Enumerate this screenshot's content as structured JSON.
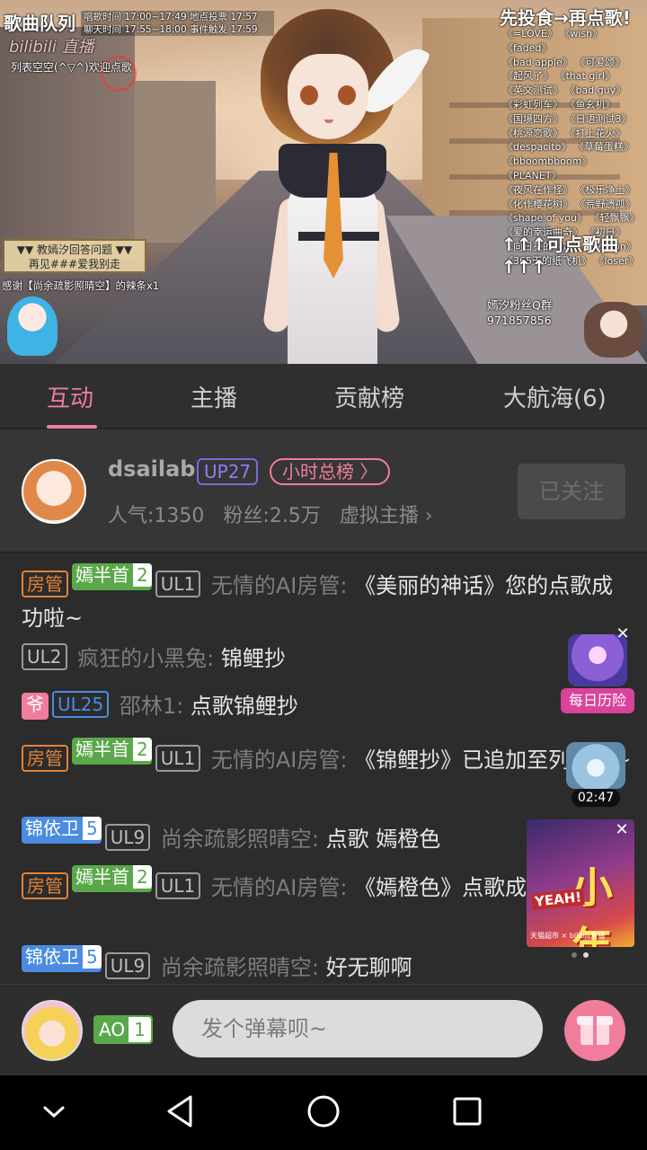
{
  "video": {
    "queue_title": "歌曲队列",
    "schedule_lines": [
      "唱歌时间 17:00~17:49   地点投票 17:57",
      "聊天时间 17:55~18:00   事件触发 17:59"
    ],
    "logo": "bilibili 直播",
    "queue_empty": "列表空空(^▽^)欢迎点歌",
    "right_title": "先投食→再点歌!",
    "songs": [
      "《=LOVE》 《wish》 《faded》",
      "《bad apple》 《可爱颂》",
      "《起风了》 《that girl》",
      "《英文测试》 《bad guy》",
      "《彩虹列车》 《鱼玄机》",
      "《国境四方》 《日语测试3》",
      "《桃源恋歌》 《打上花火》",
      "《despacito》 《草莓蛋糕》",
      "《bboombboom》 《PLANET》",
      "《夜风在作怪》 《极乐净土》",
      "《化作樱花树》 《荒野遗孤》",
      "《shape of you》 《轻飘飘》",
      "《爱的幸运曲奇》 《初日》",
      "《向日葵的约定》 《lemon》",
      "《365天的纸飞机》 《loser》"
    ],
    "song_footer": "↑↑↑可点歌曲↑↑↑",
    "qa_line1": "▼▼ 教嫣汐回答问题 ▼▼",
    "qa_line2": "再见###爱我别走",
    "thanks": "感谢【尚余疏影照晴空】的辣条x1",
    "fan_group_label": "嫣汐粉丝Q群",
    "fan_group_number": "971857856"
  },
  "tabs": [
    {
      "label": "互动",
      "active": true
    },
    {
      "label": "主播",
      "active": false
    },
    {
      "label": "贡献榜",
      "active": false
    },
    {
      "label": "大航海(6)",
      "active": false
    }
  ],
  "streamer": {
    "name": "dsailab",
    "up_level": "UP27",
    "rank_label": "小时总榜 〉",
    "popularity": "人气:1350",
    "fans": "粉丝:2.5万",
    "category": "虚拟主播 ›",
    "follow_label": "已关注"
  },
  "chat": [
    {
      "badges": [
        "房管",
        "嫣半首|2",
        "UL1"
      ],
      "user": "无情的AI房管:",
      "text": "《美丽的神话》您的点歌成功啦~"
    },
    {
      "badges": [
        "UL2"
      ],
      "user": "疯狂的小黑兔:",
      "text": "锦鲤抄"
    },
    {
      "badges": [
        "爷",
        "UL25"
      ],
      "user": "邵林1:",
      "text": "点歌锦鲤抄"
    },
    {
      "badges": [
        "房管",
        "嫣半首|2",
        "UL1"
      ],
      "user": "无情的AI房管:",
      "text": "《锦鲤抄》已追加至列表中~"
    },
    {
      "badges": [
        "锦依卫|5",
        "UL9"
      ],
      "user": "尚余疏影照晴空:",
      "text": "点歌  嫣橙色"
    },
    {
      "badges": [
        "房管",
        "嫣半首|2",
        "UL1"
      ],
      "user": "无情的AI房管:",
      "text": "《嫣橙色》点歌成功啦~"
    },
    {
      "badges": [
        "锦依卫|5",
        "UL9"
      ],
      "user": "尚余疏影照晴空:",
      "text": "好无聊啊"
    }
  ],
  "widgets": {
    "daily_label": "每日历险",
    "timer": "02:47",
    "ad_title": "小年",
    "ad_badge": "YEAH!",
    "ad_footer": "天猫超市 × bilibili直播"
  },
  "input": {
    "medal_name": "AO",
    "medal_level": "1",
    "placeholder": "发个弹幕呗~"
  },
  "colors": {
    "accent_pink": "#f07d9c",
    "fan_green": "#5aa84a",
    "guard_blue": "#4b8ce0",
    "admin_orange": "#e0833a"
  }
}
